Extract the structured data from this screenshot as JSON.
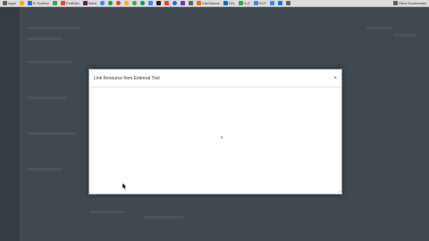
{
  "bookmarks": [
    {
      "icon": "apps-icon",
      "label": "Apps",
      "color": "#5f6368",
      "round": false
    },
    {
      "icon": "bookmark-icon",
      "label": "",
      "color": "#f4b400",
      "round": false
    },
    {
      "icon": "star-icon",
      "label": "E-Toolbox",
      "color": "#1a73e8",
      "round": false
    },
    {
      "icon": "bookmark-icon",
      "label": "",
      "color": "#34a853",
      "round": false
    },
    {
      "icon": "bookmark-icon",
      "label": "Portfolio",
      "color": "#ea4335",
      "round": false
    },
    {
      "icon": "bookmark-icon",
      "label": "Slack",
      "color": "#611f69",
      "round": false
    },
    {
      "icon": "bookmark-icon",
      "label": "",
      "color": "#4285f4",
      "round": true
    },
    {
      "icon": "bookmark-icon",
      "label": "",
      "color": "#0f9d58",
      "round": true
    },
    {
      "icon": "bookmark-icon",
      "label": "",
      "color": "#db4437",
      "round": true
    },
    {
      "icon": "bookmark-icon",
      "label": "",
      "color": "#f4b400",
      "round": true
    },
    {
      "icon": "bookmark-icon",
      "label": "",
      "color": "#34a853",
      "round": true
    },
    {
      "icon": "bookmark-icon",
      "label": "",
      "color": "#0f9d58",
      "round": true
    },
    {
      "icon": "bookmark-icon",
      "label": "",
      "color": "#4285f4",
      "round": false
    },
    {
      "icon": "bookmark-icon",
      "label": "",
      "color": "#202124",
      "round": false
    },
    {
      "icon": "bookmark-icon",
      "label": "",
      "color": "#ea4335",
      "round": false
    },
    {
      "icon": "bookmark-icon",
      "label": "",
      "color": "#1a73e8",
      "round": true
    },
    {
      "icon": "bookmark-icon",
      "label": "",
      "color": "#673ab7",
      "round": false
    },
    {
      "icon": "bookmark-icon",
      "label": "",
      "color": "#5f6368",
      "round": false
    },
    {
      "icon": "bookmark-icon",
      "label": "InfoSource",
      "color": "#e37400",
      "round": false
    },
    {
      "icon": "bookmark-icon",
      "label": "D2L",
      "color": "#006fbf",
      "round": false
    },
    {
      "icon": "bookmark-icon",
      "label": "A-Z",
      "color": "#34a853",
      "round": false
    },
    {
      "icon": "bookmark-icon",
      "label": "GCF",
      "color": "#3a8dde",
      "round": false
    },
    {
      "icon": "bookmark-icon",
      "label": "",
      "color": "#4285f4",
      "round": false
    },
    {
      "icon": "bookmark-icon",
      "label": "",
      "color": "#1a73e8",
      "round": false
    },
    {
      "icon": "bookmark-icon",
      "label": "",
      "color": "#5f6368",
      "round": false
    },
    {
      "icon": "folder-icon",
      "label": "Other Bookmarks",
      "color": "#5f6368",
      "round": false
    }
  ],
  "modal": {
    "title": "Link Resource from External Tool",
    "close_glyph": "×"
  },
  "colors": {
    "overlay": "#3b4148",
    "modal_bg": "#ffffff"
  }
}
